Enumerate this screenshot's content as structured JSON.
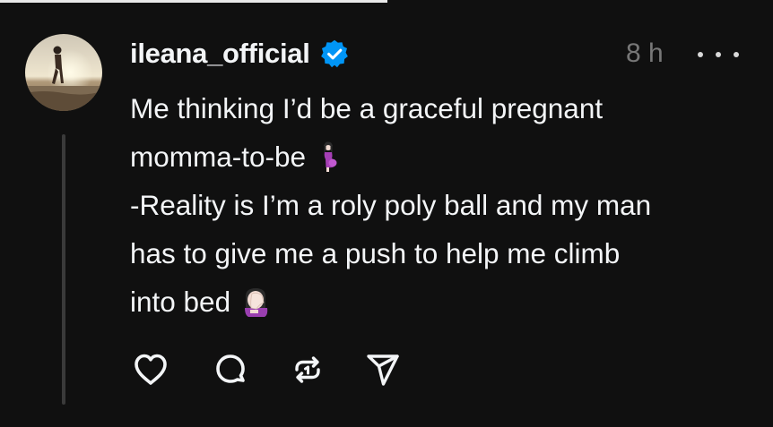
{
  "post": {
    "username": "ileana_official",
    "verified": true,
    "timestamp": "8 h",
    "text_lines": [
      "Me thinking I’d be a graceful pregnant",
      "momma-to-be",
      "-Reality is I’m a roly poly ball and my man",
      "has to give me a push to help me climb",
      "into bed"
    ],
    "emojis": [
      "pregnant-woman-emoji",
      "woman-facepalming-emoji"
    ]
  },
  "icons": {
    "verified": "verified-badge-icon",
    "more": "more-options-icon",
    "like": "heart-icon",
    "reply": "comment-icon",
    "repost": "repost-icon",
    "share": "send-icon"
  },
  "colors": {
    "background": "#101010",
    "text": "#f3f5f7",
    "muted": "#777777",
    "verified": "#0095f6",
    "thread_line": "#3a3a3a"
  }
}
